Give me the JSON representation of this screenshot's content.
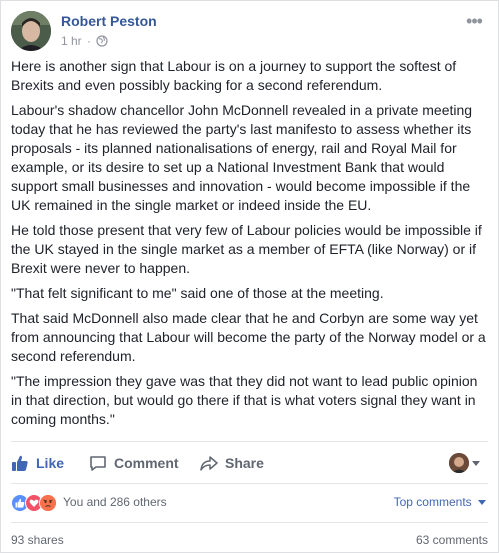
{
  "post": {
    "author": "Robert Peston",
    "time": "1 hr",
    "more_glyph": "•••",
    "paragraphs": [
      "Here is another sign that Labour is on a journey to support the softest of Brexits and even possibly backing for a second referendum.",
      "Labour's shadow chancellor John McDonnell revealed in a private meeting today that he has reviewed the party's last manifesto to assess whether its proposals - its planned nationalisations of energy, rail and Royal Mail for example, or its desire to set up a National Investment Bank that would support small businesses and innovation - would become impossible if the UK remained in the single market or indeed inside the EU.",
      "He told those present that very few of Labour policies would be impossible if the UK stayed in the single market as a member of EFTA (like Norway) or if Brexit were never to happen.",
      "\"That felt significant to me\" said one of those at the meeting.",
      "That said McDonnell also made clear that he and Corbyn are some way yet from announcing that Labour will become the party of the Norway model or a second referendum.",
      "\"The impression they gave was that they did not want to lead public opinion in that direction, but would go there if that is what voters signal they want in coming months.\""
    ]
  },
  "actions": {
    "like": "Like",
    "comment": "Comment",
    "share": "Share"
  },
  "reactions": {
    "summary": "You and 286 others",
    "icons": [
      "like-reaction-icon",
      "love-reaction-icon",
      "angry-reaction-icon"
    ],
    "sort_label": "Top comments",
    "colors": {
      "like": "#5890ff",
      "love": "#f25268",
      "angry": "#f7714c"
    }
  },
  "footer": {
    "shares": "93 shares",
    "comments": "63 comments"
  },
  "colors": {
    "link": "#365899",
    "accent": "#4267b2",
    "muted": "#90949c",
    "text": "#1d2129"
  }
}
